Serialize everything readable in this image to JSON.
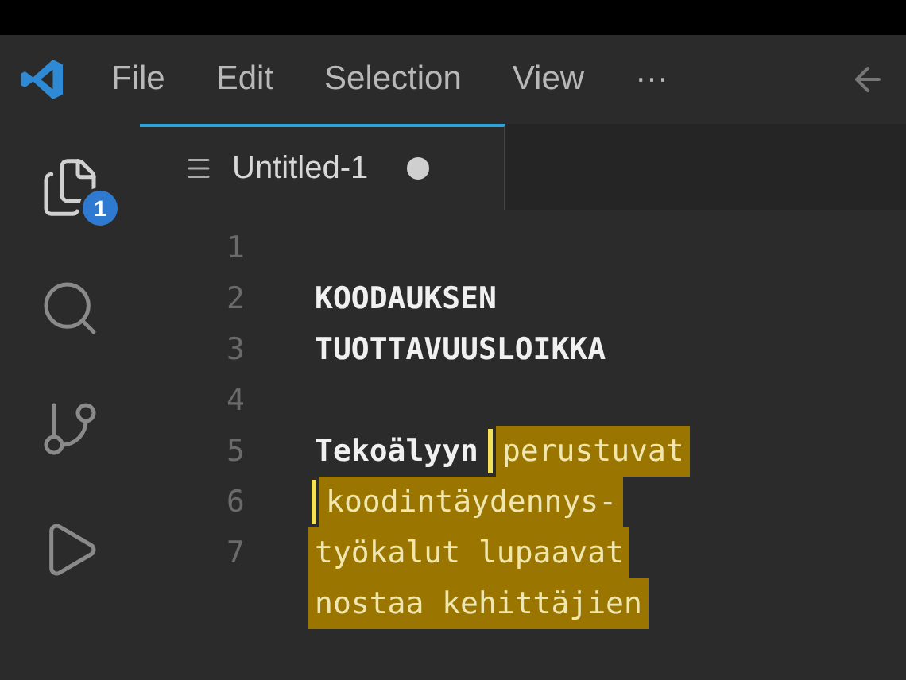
{
  "menu": [
    "File",
    "Edit",
    "Selection",
    "View",
    "···"
  ],
  "activity_bar": [
    {
      "kind": "files",
      "badge": "1",
      "selected": true
    },
    {
      "kind": "search",
      "selected": false
    },
    {
      "kind": "source-control",
      "selected": false
    },
    {
      "kind": "run",
      "selected": false
    }
  ],
  "tabs": [
    {
      "label": "Untitled-1",
      "selected": true,
      "dirty": true
    }
  ],
  "lines": [
    {
      "number": "1"
    },
    {
      "number": "2",
      "segments": [
        {
          "text": "KOODAUKSEN",
          "selected": false
        }
      ]
    },
    {
      "number": "3",
      "segments": [
        {
          "text": "TUOTTAVUUSLOIKKA",
          "selected": false
        }
      ]
    },
    {
      "number": "4"
    },
    {
      "number": "5",
      "segments": [
        {
          "text": "Tekoälyyn",
          "selected": false
        },
        {
          "text": "perustuvat",
          "selected": true
        }
      ]
    },
    {
      "number": "6",
      "segments": [
        {
          "text": "koodintäydennys-",
          "selected": true
        }
      ]
    },
    {
      "number": "7",
      "segments": [
        {
          "text": "työkalut lupaavat",
          "selected": true
        }
      ]
    },
    {
      "segments": [
        {
          "text": "nostaa kehittäjien",
          "selected": true
        }
      ]
    }
  ]
}
